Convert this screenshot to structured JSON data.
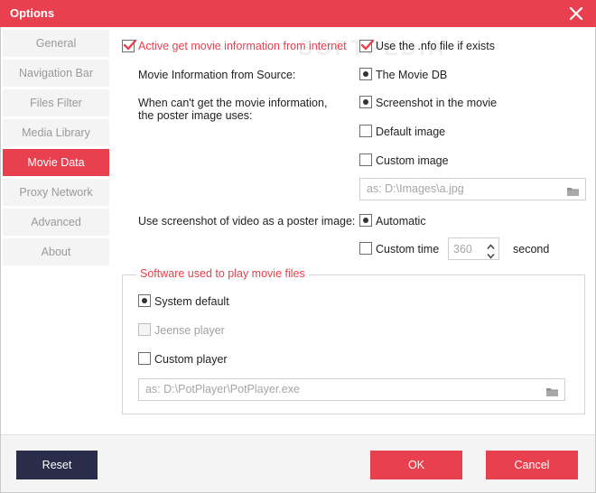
{
  "window": {
    "title": "Options",
    "accent_color": "#e8404f",
    "dark_button_color": "#2a2d4a"
  },
  "watermark": "SOFTPEDIA",
  "sidebar": {
    "items": [
      {
        "label": "General"
      },
      {
        "label": "Navigation Bar"
      },
      {
        "label": "Files Filter"
      },
      {
        "label": "Media Library"
      },
      {
        "label": "Movie Data",
        "active": true
      },
      {
        "label": "Proxy Network"
      },
      {
        "label": "Advanced"
      },
      {
        "label": "About"
      }
    ]
  },
  "movie_data": {
    "active_get_info": {
      "label": "Active get movie information from internet",
      "checked": true
    },
    "use_nfo": {
      "label": "Use the .nfo file if exists",
      "checked": true
    },
    "source": {
      "label": "Movie Information from Source:",
      "option": "The Movie DB",
      "selected": true
    },
    "poster_fallback": {
      "label_line1": "When can't get the movie information,",
      "label_line2": "the poster image uses:",
      "options": [
        {
          "label": "Screenshot in the movie",
          "selected": true
        },
        {
          "label": "Default image",
          "checked": false
        },
        {
          "label": "Custom image",
          "checked": false
        }
      ],
      "custom_image_placeholder": "as: D:\\Images\\a.jpg"
    },
    "screenshot_poster": {
      "label": "Use screenshot of video as a poster image:",
      "automatic": {
        "label": "Automatic",
        "selected": true
      },
      "custom_time": {
        "label": "Custom time",
        "checked": false,
        "value": "360",
        "unit": "second"
      }
    }
  },
  "player_group": {
    "title": "Software used to play movie files",
    "system_default": {
      "label": "System default",
      "selected": true
    },
    "jeense_player": {
      "label": "Jeense player",
      "disabled": true
    },
    "custom_player": {
      "label": "Custom player",
      "checked": false
    },
    "custom_player_placeholder": "as: D:\\PotPlayer\\PotPlayer.exe"
  },
  "footer": {
    "reset_label": "Reset",
    "ok_label": "OK",
    "cancel_label": "Cancel"
  }
}
